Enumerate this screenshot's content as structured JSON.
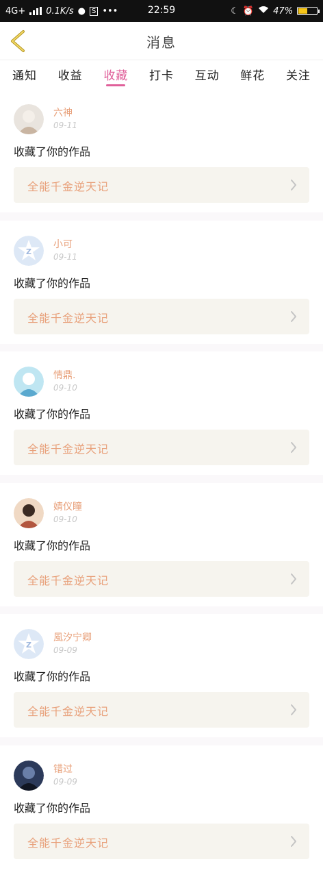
{
  "status_bar": {
    "network": "4G+",
    "speed": "0.1K/s",
    "dots": "•••",
    "time": "22:59",
    "battery": "47%"
  },
  "header": {
    "title": "消息"
  },
  "tabs": [
    {
      "label": "通知"
    },
    {
      "label": "收益"
    },
    {
      "label": "收藏",
      "active": true
    },
    {
      "label": "打卡"
    },
    {
      "label": "互动"
    },
    {
      "label": "鲜花"
    },
    {
      "label": "关注"
    }
  ],
  "items": [
    {
      "name": "六神",
      "date": "09-11",
      "message": "收藏了你的作品",
      "work": "全能千金逆天记",
      "avatar": "photo-girl"
    },
    {
      "name": "小可",
      "date": "09-11",
      "message": "收藏了你的作品",
      "work": "全能千金逆天记",
      "avatar": "default"
    },
    {
      "name": "情鼎.",
      "date": "09-10",
      "message": "收藏了你的作品",
      "work": "全能千金逆天记",
      "avatar": "photo-anime"
    },
    {
      "name": "婧仪瞳",
      "date": "09-10",
      "message": "收藏了你的作品",
      "work": "全能千金逆天记",
      "avatar": "photo-costume"
    },
    {
      "name": "風汐宁卿",
      "date": "09-09",
      "message": "收藏了你的作品",
      "work": "全能千金逆天记",
      "avatar": "default"
    },
    {
      "name": "错过",
      "date": "09-09",
      "message": "收藏了你的作品",
      "work": "全能千金逆天记",
      "avatar": "photo-dark"
    }
  ],
  "colors": {
    "accent": "#e0609a",
    "name": "#e8a07a",
    "card_bg": "#f6f4ee"
  }
}
